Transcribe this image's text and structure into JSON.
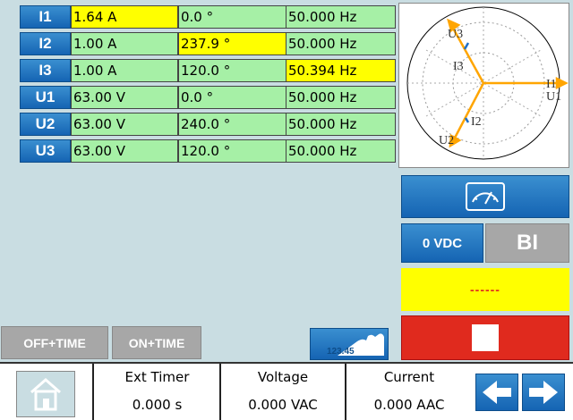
{
  "channels": [
    {
      "name": "I1",
      "magnitude": "1.64 A",
      "angle": "0.0 °",
      "frequency": "50.000 Hz",
      "hl": [
        true,
        false,
        false
      ]
    },
    {
      "name": "I2",
      "magnitude": "1.00 A",
      "angle": "237.9 °",
      "frequency": "50.000 Hz",
      "hl": [
        false,
        true,
        false
      ]
    },
    {
      "name": "I3",
      "magnitude": "1.00 A",
      "angle": "120.0 °",
      "frequency": "50.394 Hz",
      "hl": [
        false,
        false,
        true
      ]
    },
    {
      "name": "U1",
      "magnitude": "63.00 V",
      "angle": "0.0 °",
      "frequency": "50.000 Hz",
      "hl": [
        false,
        false,
        false
      ]
    },
    {
      "name": "U2",
      "magnitude": "63.00 V",
      "angle": "240.0 °",
      "frequency": "50.000 Hz",
      "hl": [
        false,
        false,
        false
      ]
    },
    {
      "name": "U3",
      "magnitude": "63.00 V",
      "angle": "120.0 °",
      "frequency": "50.000 Hz",
      "hl": [
        false,
        false,
        false
      ]
    }
  ],
  "phasor": {
    "labels": {
      "u3": "U3",
      "i3": "I3",
      "i1": "I1",
      "u1": "U1",
      "i2": "I2",
      "u2": "U2"
    },
    "voltage_color": "#ffa500",
    "current_color": "#1e6fc8"
  },
  "controls": {
    "vdc_label": "0 VDC",
    "bi_label": "BI",
    "status_text": "------",
    "off_time_label": "OFF+TIME",
    "on_time_label": "ON+TIME",
    "numeric_icon_text": "123.45"
  },
  "footer": {
    "ext_timer_label": "Ext Timer",
    "ext_timer_value": "0.000 s",
    "voltage_label": "Voltage",
    "voltage_value": "0.000 VAC",
    "current_label": "Current",
    "current_value": "0.000 AAC"
  },
  "colors": {
    "stop_red": "#e02a1e",
    "status_yellow": "#ffff00",
    "accent_blue": "#1564b3"
  }
}
